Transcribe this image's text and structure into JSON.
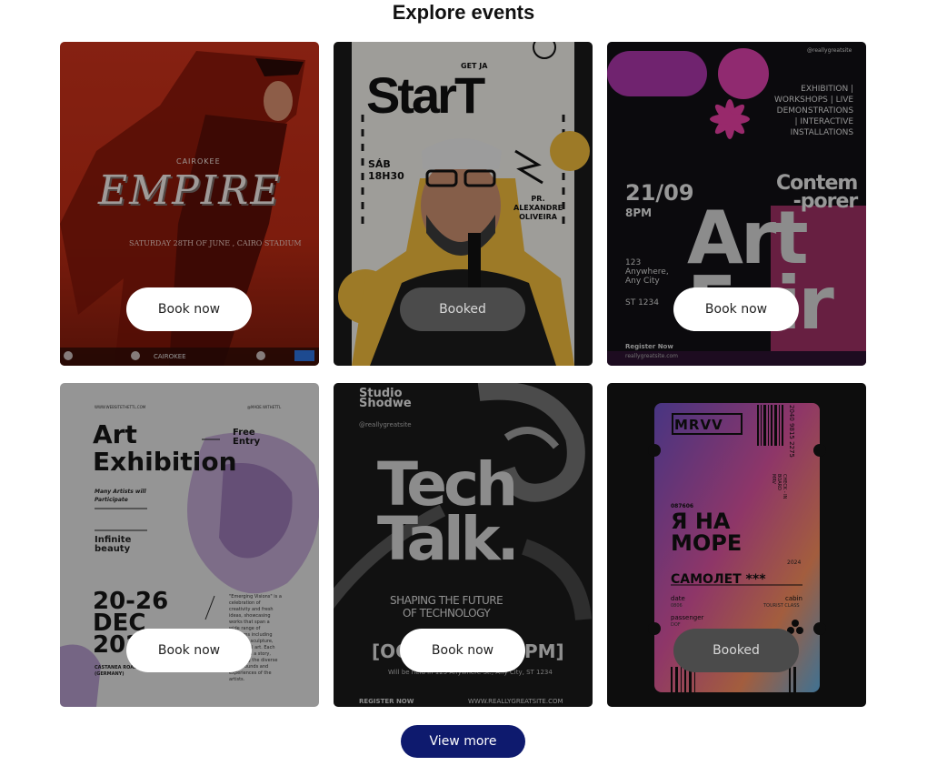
{
  "page": {
    "title": "Explore events"
  },
  "events": [
    {
      "status": "Book now",
      "poster": {
        "brand": "CAIROKEE",
        "headline": "EMPIRE",
        "subline": "SATURDAY 28TH OF JUNE , CAIRO STADIUM",
        "footer": "CAIROKEE"
      }
    },
    {
      "status": "Booked",
      "poster": {
        "top": "GET JA",
        "headline": "StarT",
        "date": "SÁB\n18H30",
        "speaker": "PR.\nALEXANDRE\nOLIVEIRA"
      }
    },
    {
      "status": "Book now",
      "poster": {
        "handle": "@reallygreatsite",
        "info": "EXHIBITION |\nWORKSHOPS | LIVE\nDEMONSTRATIONS\n| INTERACTIVE\nINSTALLATIONS",
        "date": "21/09",
        "time": "8PM",
        "headline_small": "Contem\n-porer",
        "headline": "Art\nFair",
        "address": "123\nAnywhere,\nAny City",
        "zip": "ST 1234",
        "register": "Register Now",
        "email": "reallygreatsite.com"
      }
    },
    {
      "status": "Book now",
      "poster": {
        "url": "WWW.WEBSITETHETTL.COM",
        "handle": "@MADE.WITHETTL",
        "headline": "Art\nExhibition",
        "entry": "Free\nEntry",
        "sub": "Many Artists will\nParticipate",
        "tag": "Infinite\nbeauty",
        "date": "20-26\nDEC\n2024",
        "venue": "CASTANEA ROAD, BERLIN,\n(GERMANY)",
        "desc": "\"Emerging Visions\" is a\ncelebration of\ncreativity and fresh\nideas, showcasing\nworks that span a\nwide range of\nmediums including\npainting, sculpture,\nand digital art. Each\npiece tells a story,\nreflecting the diverse\nbackgrounds and\nexperiences of the\nartists."
      }
    },
    {
      "status": "Book now",
      "poster": {
        "studio": "Studio\nShodwe",
        "handle": "@reallygreatsite",
        "headline": "Tech\nTalk.",
        "sub": "SHAPING THE FUTURE\nOF TECHNOLOGY",
        "date": "[OC",
        "time": "PM]",
        "address": "Will be held in 123 Anywhere St., Any City, ST 1234",
        "register": "REGISTER NOW",
        "site": "WWW.REALLYGREATSITE.COM"
      }
    },
    {
      "status": "Booked",
      "poster": {
        "brand": "MRVV",
        "code": "2040 9815 2275",
        "check": "CHECK - IN\nBOARD\nMRV",
        "num": "087606",
        "headline": "Я НА\nМОРЕ",
        "year": "2024",
        "sub": "САМОЛЕТ ***",
        "date_label": "date",
        "date_val": "0806",
        "class_label": "cabin",
        "class_val": "TOURIST CLASS",
        "pass_label": "passenger",
        "pass_val": "DOF"
      }
    }
  ],
  "actions": {
    "view_more": "View more"
  }
}
